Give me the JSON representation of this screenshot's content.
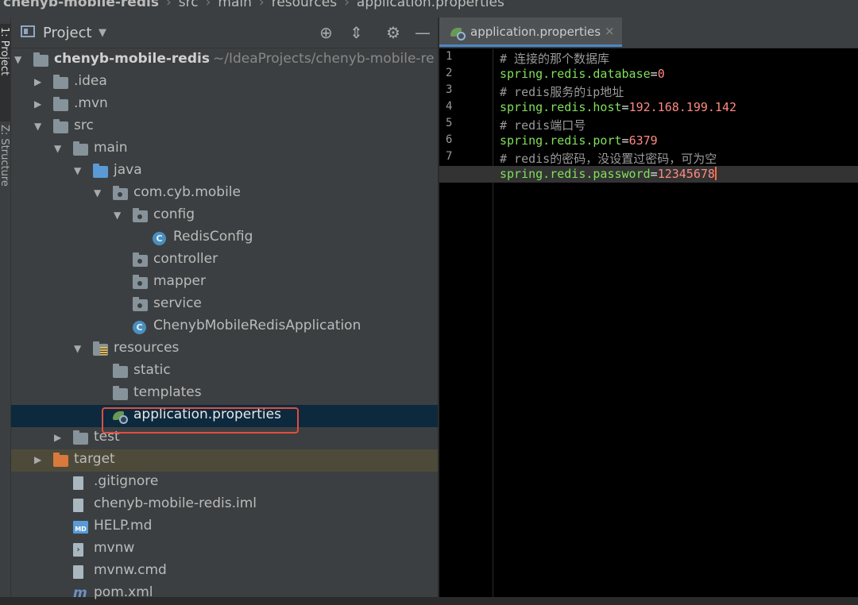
{
  "breadcrumb": [
    "chenyb-mobile-redis",
    "src",
    "main",
    "resources",
    "application.properties"
  ],
  "side_tabs": {
    "project": "1: Project",
    "structure": "Z: Structure"
  },
  "project_panel": {
    "title": "Project",
    "toolbar_icons": [
      "locate-icon",
      "collapse-icon",
      "gear-icon",
      "minimize-icon"
    ]
  },
  "tree": [
    {
      "label": "chenyb-mobile-redis",
      "hint": "~/IdeaProjects/chenyb-mobile-re",
      "icon": "module-folder-icon",
      "indent": 0,
      "expanded": true,
      "bold": true
    },
    {
      "label": ".idea",
      "icon": "folder-icon",
      "indent": 1,
      "expanded": false
    },
    {
      "label": ".mvn",
      "icon": "folder-icon",
      "indent": 1,
      "expanded": false
    },
    {
      "label": "src",
      "icon": "folder-icon",
      "indent": 1,
      "expanded": true
    },
    {
      "label": "main",
      "icon": "folder-icon",
      "indent": 2,
      "expanded": true
    },
    {
      "label": "java",
      "icon": "source-folder-icon",
      "indent": 3,
      "expanded": true
    },
    {
      "label": "com.cyb.mobile",
      "icon": "package-icon",
      "indent": 4,
      "expanded": true
    },
    {
      "label": "config",
      "icon": "package-icon",
      "indent": 5,
      "expanded": true
    },
    {
      "label": "RedisConfig",
      "icon": "class-icon",
      "indent": 6
    },
    {
      "label": "controller",
      "icon": "package-icon",
      "indent": 5
    },
    {
      "label": "mapper",
      "icon": "package-icon",
      "indent": 5
    },
    {
      "label": "service",
      "icon": "package-icon",
      "indent": 5
    },
    {
      "label": "ChenybMobileRedisApplication",
      "icon": "spring-boot-class-icon",
      "indent": 5
    },
    {
      "label": "resources",
      "icon": "resources-folder-icon",
      "indent": 3,
      "expanded": true
    },
    {
      "label": "static",
      "icon": "folder-icon",
      "indent": 4
    },
    {
      "label": "templates",
      "icon": "folder-icon",
      "indent": 4
    },
    {
      "label": "application.properties",
      "icon": "spring-properties-icon",
      "indent": 4,
      "selected": true
    },
    {
      "label": "test",
      "icon": "folder-icon",
      "indent": 2,
      "expanded": false
    },
    {
      "label": "target",
      "icon": "excluded-folder-icon",
      "indent": 1,
      "expanded": false,
      "excluded": true
    },
    {
      "label": ".gitignore",
      "icon": "file-icon",
      "indent": 2
    },
    {
      "label": "chenyb-mobile-redis.iml",
      "icon": "file-icon",
      "indent": 2
    },
    {
      "label": "HELP.md",
      "icon": "markdown-icon",
      "indent": 2
    },
    {
      "label": "mvnw",
      "icon": "terminal-file-icon",
      "indent": 2
    },
    {
      "label": "mvnw.cmd",
      "icon": "file-icon",
      "indent": 2
    },
    {
      "label": "pom.xml",
      "icon": "maven-icon",
      "indent": 2
    }
  ],
  "editor": {
    "tab": {
      "name": "application.properties",
      "close": "×"
    },
    "lines": [
      {
        "n": "1",
        "kind": "comment",
        "text": "# 连接的那个数据库"
      },
      {
        "n": "2",
        "kind": "prop",
        "key": "spring.redis.database",
        "value": "0"
      },
      {
        "n": "3",
        "kind": "comment",
        "text": "# redis服务的ip地址"
      },
      {
        "n": "4",
        "kind": "prop",
        "key": "spring.redis.host",
        "value": "192.168.199.142"
      },
      {
        "n": "5",
        "kind": "comment",
        "text": "# redis端口号"
      },
      {
        "n": "6",
        "kind": "prop",
        "key": "spring.redis.port",
        "value": "6379"
      },
      {
        "n": "7",
        "kind": "comment",
        "text": "# redis的密码，没设置过密码，可为空"
      },
      {
        "n": "",
        "kind": "prop",
        "key": "spring.redis.password",
        "value": "12345678",
        "current": true
      }
    ]
  }
}
